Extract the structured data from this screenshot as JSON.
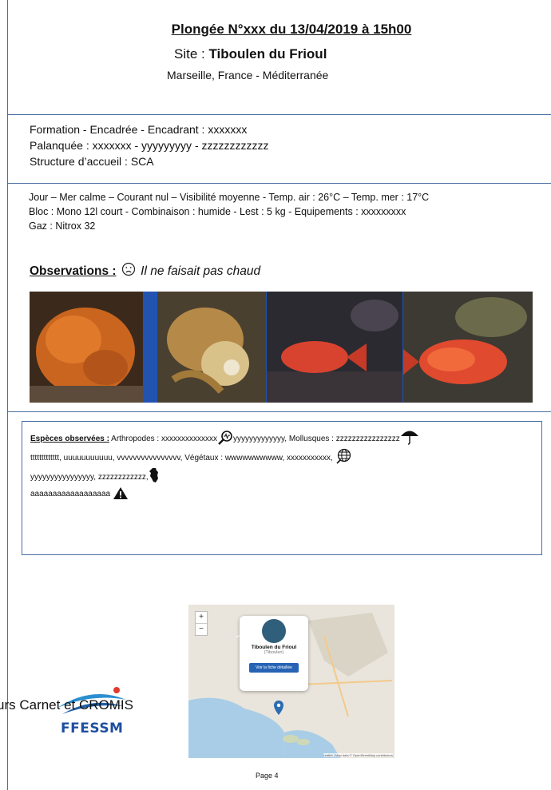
{
  "header": {
    "title": "Plongée N°xxx du 13/04/2019 à 15h00",
    "site_label": "Site : ",
    "site_name": "Tiboulen du Frioul",
    "location": "Marseille, France - Méditerranée"
  },
  "dive_info": {
    "formation": "Formation - Encadrée - Encadrant : xxxxxxx",
    "palanquee": "Palanquée : xxxxxxx - yyyyyyyyy - zzzzzzzzzzzz",
    "structure": "Structure d’accueil : SCA"
  },
  "conditions": {
    "line1": "Jour – Mer calme – Courant nul – Visibilité moyenne - Temp. air : 26°C – Temp. mer : 17°C",
    "line2": "Bloc : Mono 12l court - Combinaison : humide - Lest : 5 kg - Equipements : xxxxxxxxx",
    "line3": "Gaz : Nitrox 32"
  },
  "observations": {
    "label": "Observations :",
    "mood_icon": "sad-face-icon",
    "text": "Il ne faisait pas chaud"
  },
  "photos": [
    "orange-sponge-photo",
    "octopus-photo",
    "red-fish-photo",
    "red-fish-closeup-photo"
  ],
  "species": {
    "label": "Espèces observées :",
    "seg1": " Arthropodes : xxxxxxxxxxxxxx",
    "seg2": "yyyyyyyyyyyyy, Mollusques : zzzzzzzzzzzzzzzz",
    "seg3": "ttttttttttttt, uuuuuuuuuuu, vvvvvvvvvvvvvvvv, Végétaux : wwwwwwwwww,  xxxxxxxxxxx,",
    "seg4": "yyyyyyyyyyyyyyyy, zzzzzzzzzzzz,",
    "seg5": "aaaaaaaaaaaaaaaaaa"
  },
  "footer": {
    "overlap_text": "urs Carnet et CROMIS",
    "logo_text": "FFESSM",
    "map": {
      "zoom_in": "+",
      "zoom_out": "−",
      "popup_title": "Tiboulen du Frioul",
      "popup_subtitle": "(Tiboulen)",
      "popup_button": "Voir la fiche détaillée",
      "attribution": "Leaflet | Map data © OpenStreetMap contributors"
    },
    "page_number": "Page 4"
  },
  "colors": {
    "rule": "#4a6fa5",
    "photo_bg": "#2353b0",
    "logo_blue": "#1f4fa0"
  }
}
